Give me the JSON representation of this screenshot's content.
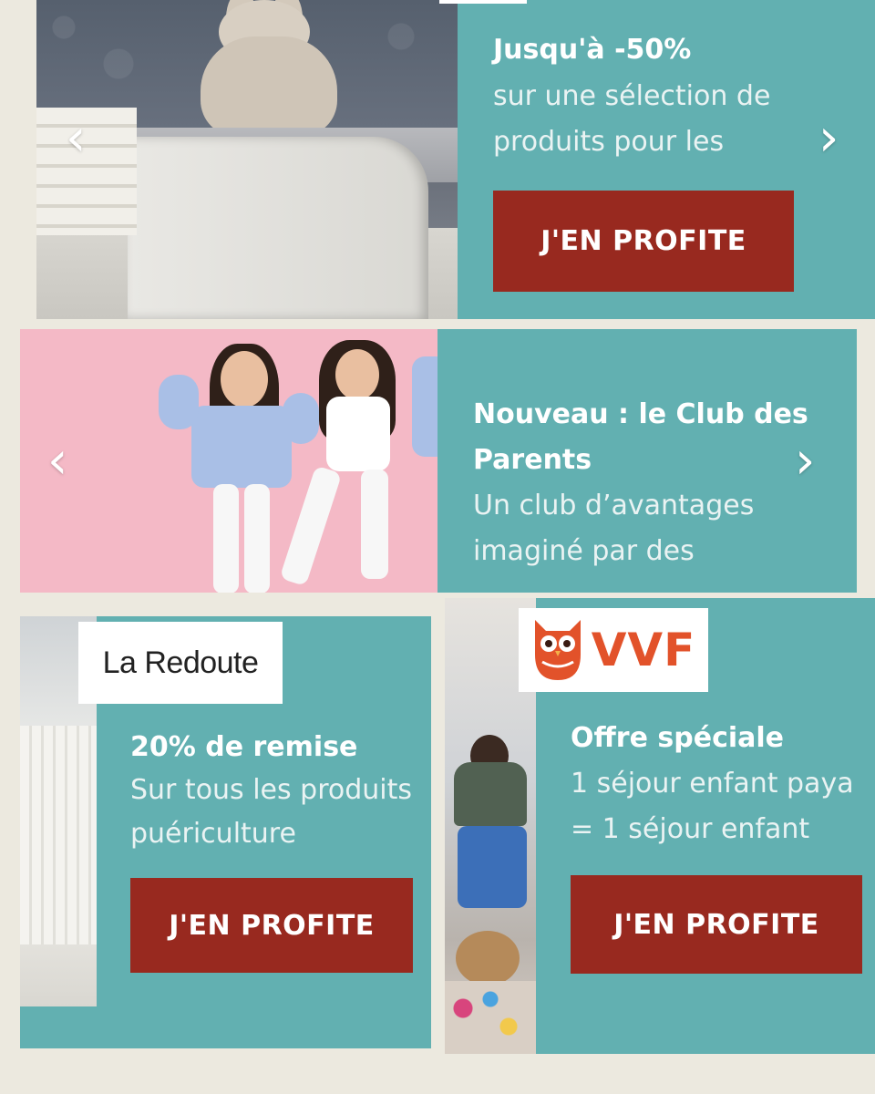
{
  "colors": {
    "page_background": "#ece9df",
    "card_teal": "#62b0b1",
    "cta_red": "#98291f",
    "vvf_orange": "#e2522a"
  },
  "carousel_1": {
    "title": "Jusqu'à -50%",
    "description_line1": "sur une sélection de",
    "description_line2": "produits pour les",
    "cta_label": "J'EN PROFITE",
    "prev_icon": "‹",
    "next_icon": "›"
  },
  "carousel_2": {
    "title_line1": "Nouveau : le Club des",
    "title_line2": "Parents",
    "description_line1": "Un club d’avantages",
    "description_line2": "imaginé par des",
    "prev_icon": "‹",
    "next_icon": "›"
  },
  "offer_laredoute": {
    "logo_text": "La Redoute",
    "title": "20% de remise",
    "description_line1": "Sur tous les produits",
    "description_line2": "puériculture",
    "cta_label": "J'EN PROFITE"
  },
  "offer_vvf": {
    "logo_text": "VVF",
    "logo_icon": "owl-icon",
    "title": "Offre spéciale",
    "description_line1": "1 séjour enfant paya",
    "description_line2": "= 1 séjour enfant",
    "cta_label": "J'EN PROFITE"
  }
}
